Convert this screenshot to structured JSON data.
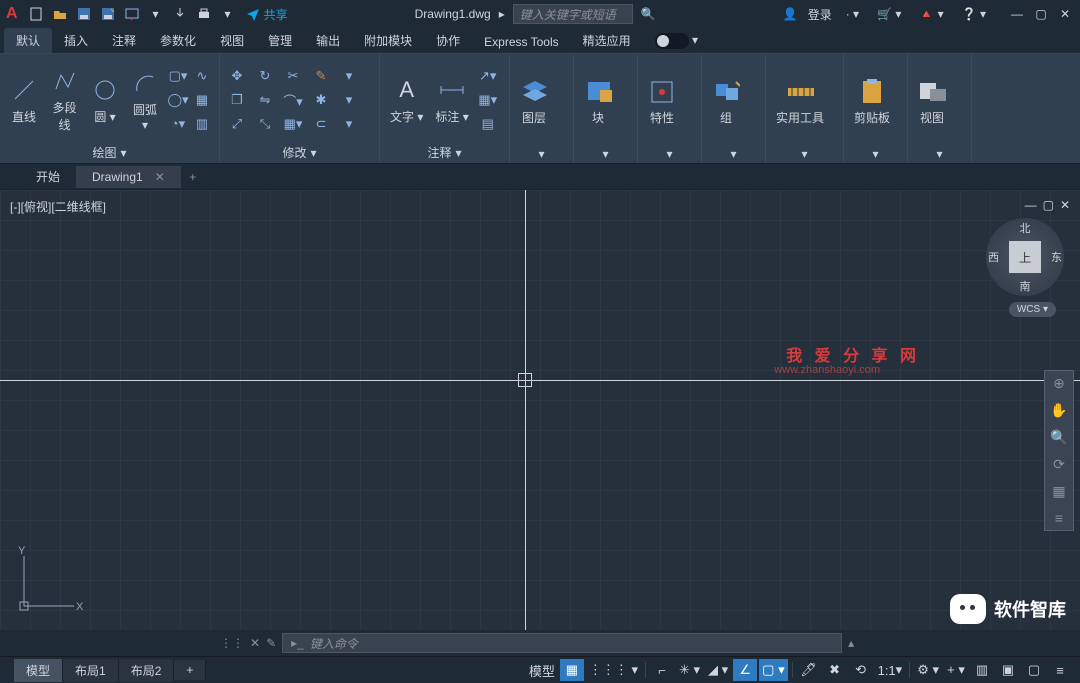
{
  "app": {
    "letter": "A"
  },
  "title": {
    "file": "Drawing1.dwg"
  },
  "search": {
    "placeholder": "键入关键字或短语"
  },
  "login": {
    "label": "登录"
  },
  "share": {
    "label": "共享"
  },
  "ribbon_tabs": [
    "默认",
    "插入",
    "注释",
    "参数化",
    "视图",
    "管理",
    "输出",
    "附加模块",
    "协作",
    "Express Tools",
    "精选应用"
  ],
  "panels": {
    "draw": {
      "label": "绘图",
      "btns": {
        "line": "直线",
        "pline": "多段线",
        "circle": "圆",
        "arc": "圆弧"
      }
    },
    "modify": {
      "label": "修改"
    },
    "annot": {
      "label": "注释",
      "btns": {
        "text": "文字",
        "dim": "标注"
      }
    },
    "layer": {
      "label": "图层"
    },
    "block": {
      "label": "块"
    },
    "prop": {
      "label": "特性"
    },
    "group": {
      "label": "组"
    },
    "util": {
      "label": "实用工具"
    },
    "clip": {
      "label": "剪贴板"
    },
    "view": {
      "label": "视图"
    }
  },
  "doctabs": {
    "start": "开始",
    "drawing": "Drawing1"
  },
  "viewport": {
    "label": "[-][俯视][二维线框]"
  },
  "compass": {
    "up": "上",
    "n": "北",
    "s": "南",
    "e": "东",
    "w": "西",
    "wcs": "WCS"
  },
  "watermark": {
    "t1": "我 爱 分 享 网",
    "t2": "www.zhanshaoyi.com"
  },
  "footer_brand": "软件智库",
  "cmd": {
    "placeholder": "键入命令"
  },
  "layout_tabs": {
    "model": "模型",
    "l1": "布局1",
    "l2": "布局2"
  },
  "status": {
    "model": "模型",
    "scale": "1:1"
  },
  "ucs": {
    "x": "X",
    "y": "Y"
  }
}
